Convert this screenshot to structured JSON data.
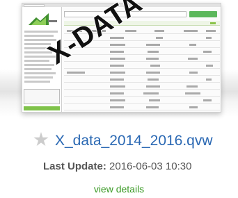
{
  "thumbnail": {
    "watermark_text": "X-DATA",
    "accent_color": "#5cb85c"
  },
  "document": {
    "star_icon": "star-icon",
    "title": "X_data_2014_2016.qvw",
    "last_update_label": "Last Update:",
    "last_update_value": "2016-06-03 10:30",
    "view_details_label": "view details"
  },
  "colors": {
    "title": "#2a68b3",
    "view_details": "#3b9a26",
    "meta_text": "#555555"
  }
}
